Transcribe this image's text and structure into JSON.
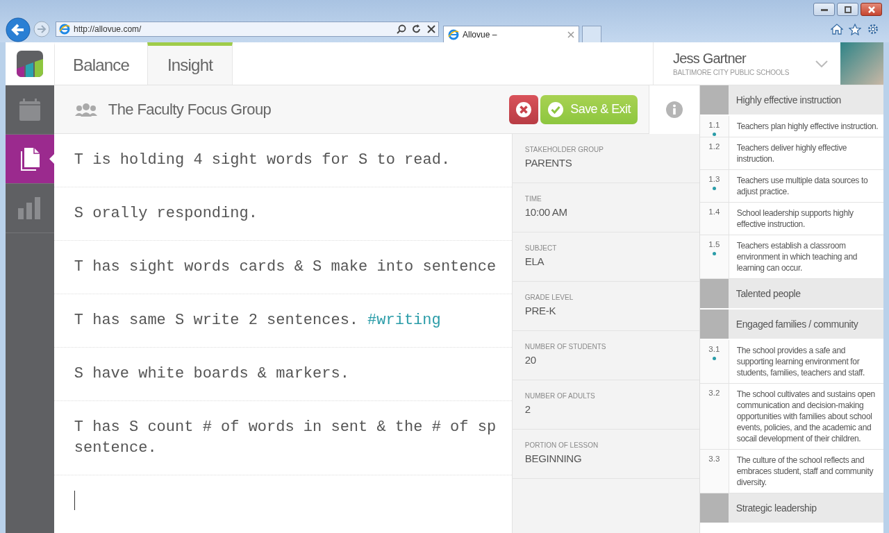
{
  "browser": {
    "url": "http://allovue.com/",
    "tab_title": "Allovue –"
  },
  "nav_tabs": [
    {
      "label": "Balance",
      "selected": false
    },
    {
      "label": "Insight",
      "selected": true
    }
  ],
  "user": {
    "name": "Jess Gartner",
    "organization": "BALTIMORE CITY PUBLIC SCHOOLS"
  },
  "sidebar": {
    "items": [
      {
        "kind": "calendar",
        "selected": false
      },
      {
        "kind": "document",
        "selected": true
      },
      {
        "kind": "chart",
        "selected": false
      }
    ]
  },
  "session": {
    "title": "The Faculty Focus Group",
    "save_label": "Save & Exit"
  },
  "notes": [
    {
      "lines": [
        "T is holding 4 sight words for S to read."
      ]
    },
    {
      "lines": [
        "S orally responding."
      ]
    },
    {
      "lines": [
        "T has sight words cards & S make into sentence"
      ]
    },
    {
      "lines": [
        "T has same S write 2 sentences."
      ],
      "tag": "#writing"
    },
    {
      "lines": [
        "S have white boards & markers."
      ]
    },
    {
      "lines": [
        "T has S count # of words in sent & the # of sp",
        "sentence."
      ]
    }
  ],
  "details": [
    {
      "label": "STAKEHOLDER GROUP",
      "value": "PARENTS"
    },
    {
      "label": "TIME",
      "value": "10:00 AM"
    },
    {
      "label": "SUBJECT",
      "value": "ELA"
    },
    {
      "label": "GRADE LEVEL",
      "value": "PRE-K"
    },
    {
      "label": "NUMBER OF STUDENTS",
      "value": "20"
    },
    {
      "label": "NUMBER OF ADULTS",
      "value": "2"
    },
    {
      "label": "PORTION OF LESSON",
      "value": "BEGINNING"
    }
  ],
  "standards": [
    {
      "title": "Highly effective instruction",
      "items": [
        {
          "number": "1.1",
          "text": "Teachers plan highly effective instruction.",
          "marked": true
        },
        {
          "number": "1.2",
          "text": "Teachers deliver highly effective instruction.",
          "marked": false
        },
        {
          "number": "1.3",
          "text": "Teachers use multiple data sources to adjust practice.",
          "marked": true
        },
        {
          "number": "1.4",
          "text": "School leadership supports highly effective instruction.",
          "marked": false
        },
        {
          "number": "1.5",
          "text": "Teachers establish a classroom environment in which teaching and learning can occur.",
          "marked": true
        }
      ]
    },
    {
      "title": "Talented people"
    },
    {
      "title": "Engaged families / community",
      "items": [
        {
          "number": "3.1",
          "text": "The school provides a safe and supporting learning environment for students, families, teachers and staff.",
          "marked": true
        },
        {
          "number": "3.2",
          "text": "The school cultivates and sustains open communication and decision-making opportunities with families about school events, policies, and the academic and socail development of their children.",
          "marked": false
        },
        {
          "number": "3.3",
          "text": "The culture of the school reflects and embraces student, staff and community diversity.",
          "marked": false
        }
      ]
    },
    {
      "title": "Strategic leadership"
    }
  ]
}
